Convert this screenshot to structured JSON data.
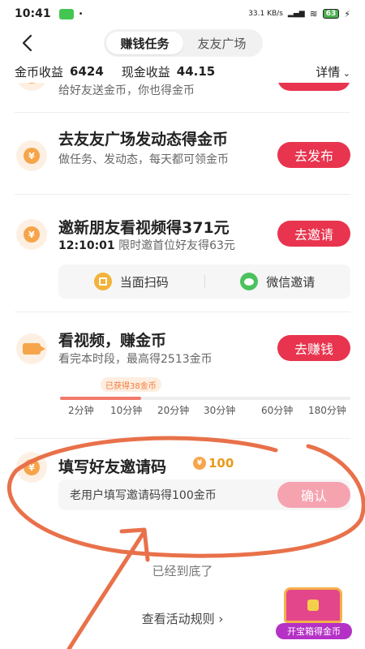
{
  "status": {
    "time": "10:41",
    "speed": "33.1 KB/s",
    "battery": "63"
  },
  "header": {
    "tabs": [
      "赚钱任务",
      "友友广场"
    ],
    "active_tab": 0
  },
  "earnings": {
    "coin_label": "金币收益",
    "coin_value": "6424",
    "cash_label": "现金收益",
    "cash_value": "44.15",
    "detail_label": "详情"
  },
  "tasks": [
    {
      "subtitle": "给好友送金币，你也得金币"
    },
    {
      "title": "去友友广场发动态得金币",
      "subtitle": "做任务、发动态，每天都可领金币",
      "button": "去发布"
    },
    {
      "title": "邀新朋友看视频得371元",
      "countdown": "12:10:01",
      "subtitle_tail": "限时邀首位好友得63元",
      "button": "去邀请",
      "invite_options": [
        "当面扫码",
        "微信邀请"
      ]
    },
    {
      "title": "看视频，赚金币",
      "subtitle": "看完本时段，最高得2513金币",
      "button": "去赚钱",
      "progress": {
        "badge": "已获得38金币",
        "fraction": 0.28,
        "milestones": [
          "2分钟",
          "10分钟",
          "20分钟",
          "30分钟",
          "60分钟",
          "180分钟"
        ]
      }
    },
    {
      "title": "填写好友邀请码",
      "reward": "100",
      "placeholder": "老用户填写邀请码得100金币",
      "button": "确认"
    }
  ],
  "footer": {
    "end_text": "已经到底了",
    "rules": "查看活动规则 ›",
    "treasure": "开宝箱得金币"
  },
  "colors": {
    "primary_button": "#e8344e",
    "coin": "#f6a54a",
    "annotation": "#e8714a"
  }
}
